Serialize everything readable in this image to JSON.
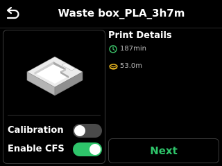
{
  "header": {
    "title": "Waste box_PLA_3h7m",
    "back_icon": "back-arrow-icon"
  },
  "preview": {
    "image": "waste-box-3d-model",
    "model_color": "#dcdcdc"
  },
  "settings": {
    "calibration": {
      "label": "Calibration",
      "on": false
    },
    "enable_cfs": {
      "label": "Enable CFS",
      "on": true
    }
  },
  "details": {
    "title": "Print Details",
    "time": {
      "icon": "clock-icon",
      "value": "187min"
    },
    "filament": {
      "icon": "filament-spool-icon",
      "value": "53.0m"
    }
  },
  "next_button": {
    "label": "Next"
  },
  "colors": {
    "accent": "#2ec46a",
    "icon_green": "#3cc46a",
    "icon_yellow": "#e0b020",
    "toggle_off": "#4a4a4a",
    "text_secondary": "#bdbdbd",
    "background": "#000000"
  }
}
